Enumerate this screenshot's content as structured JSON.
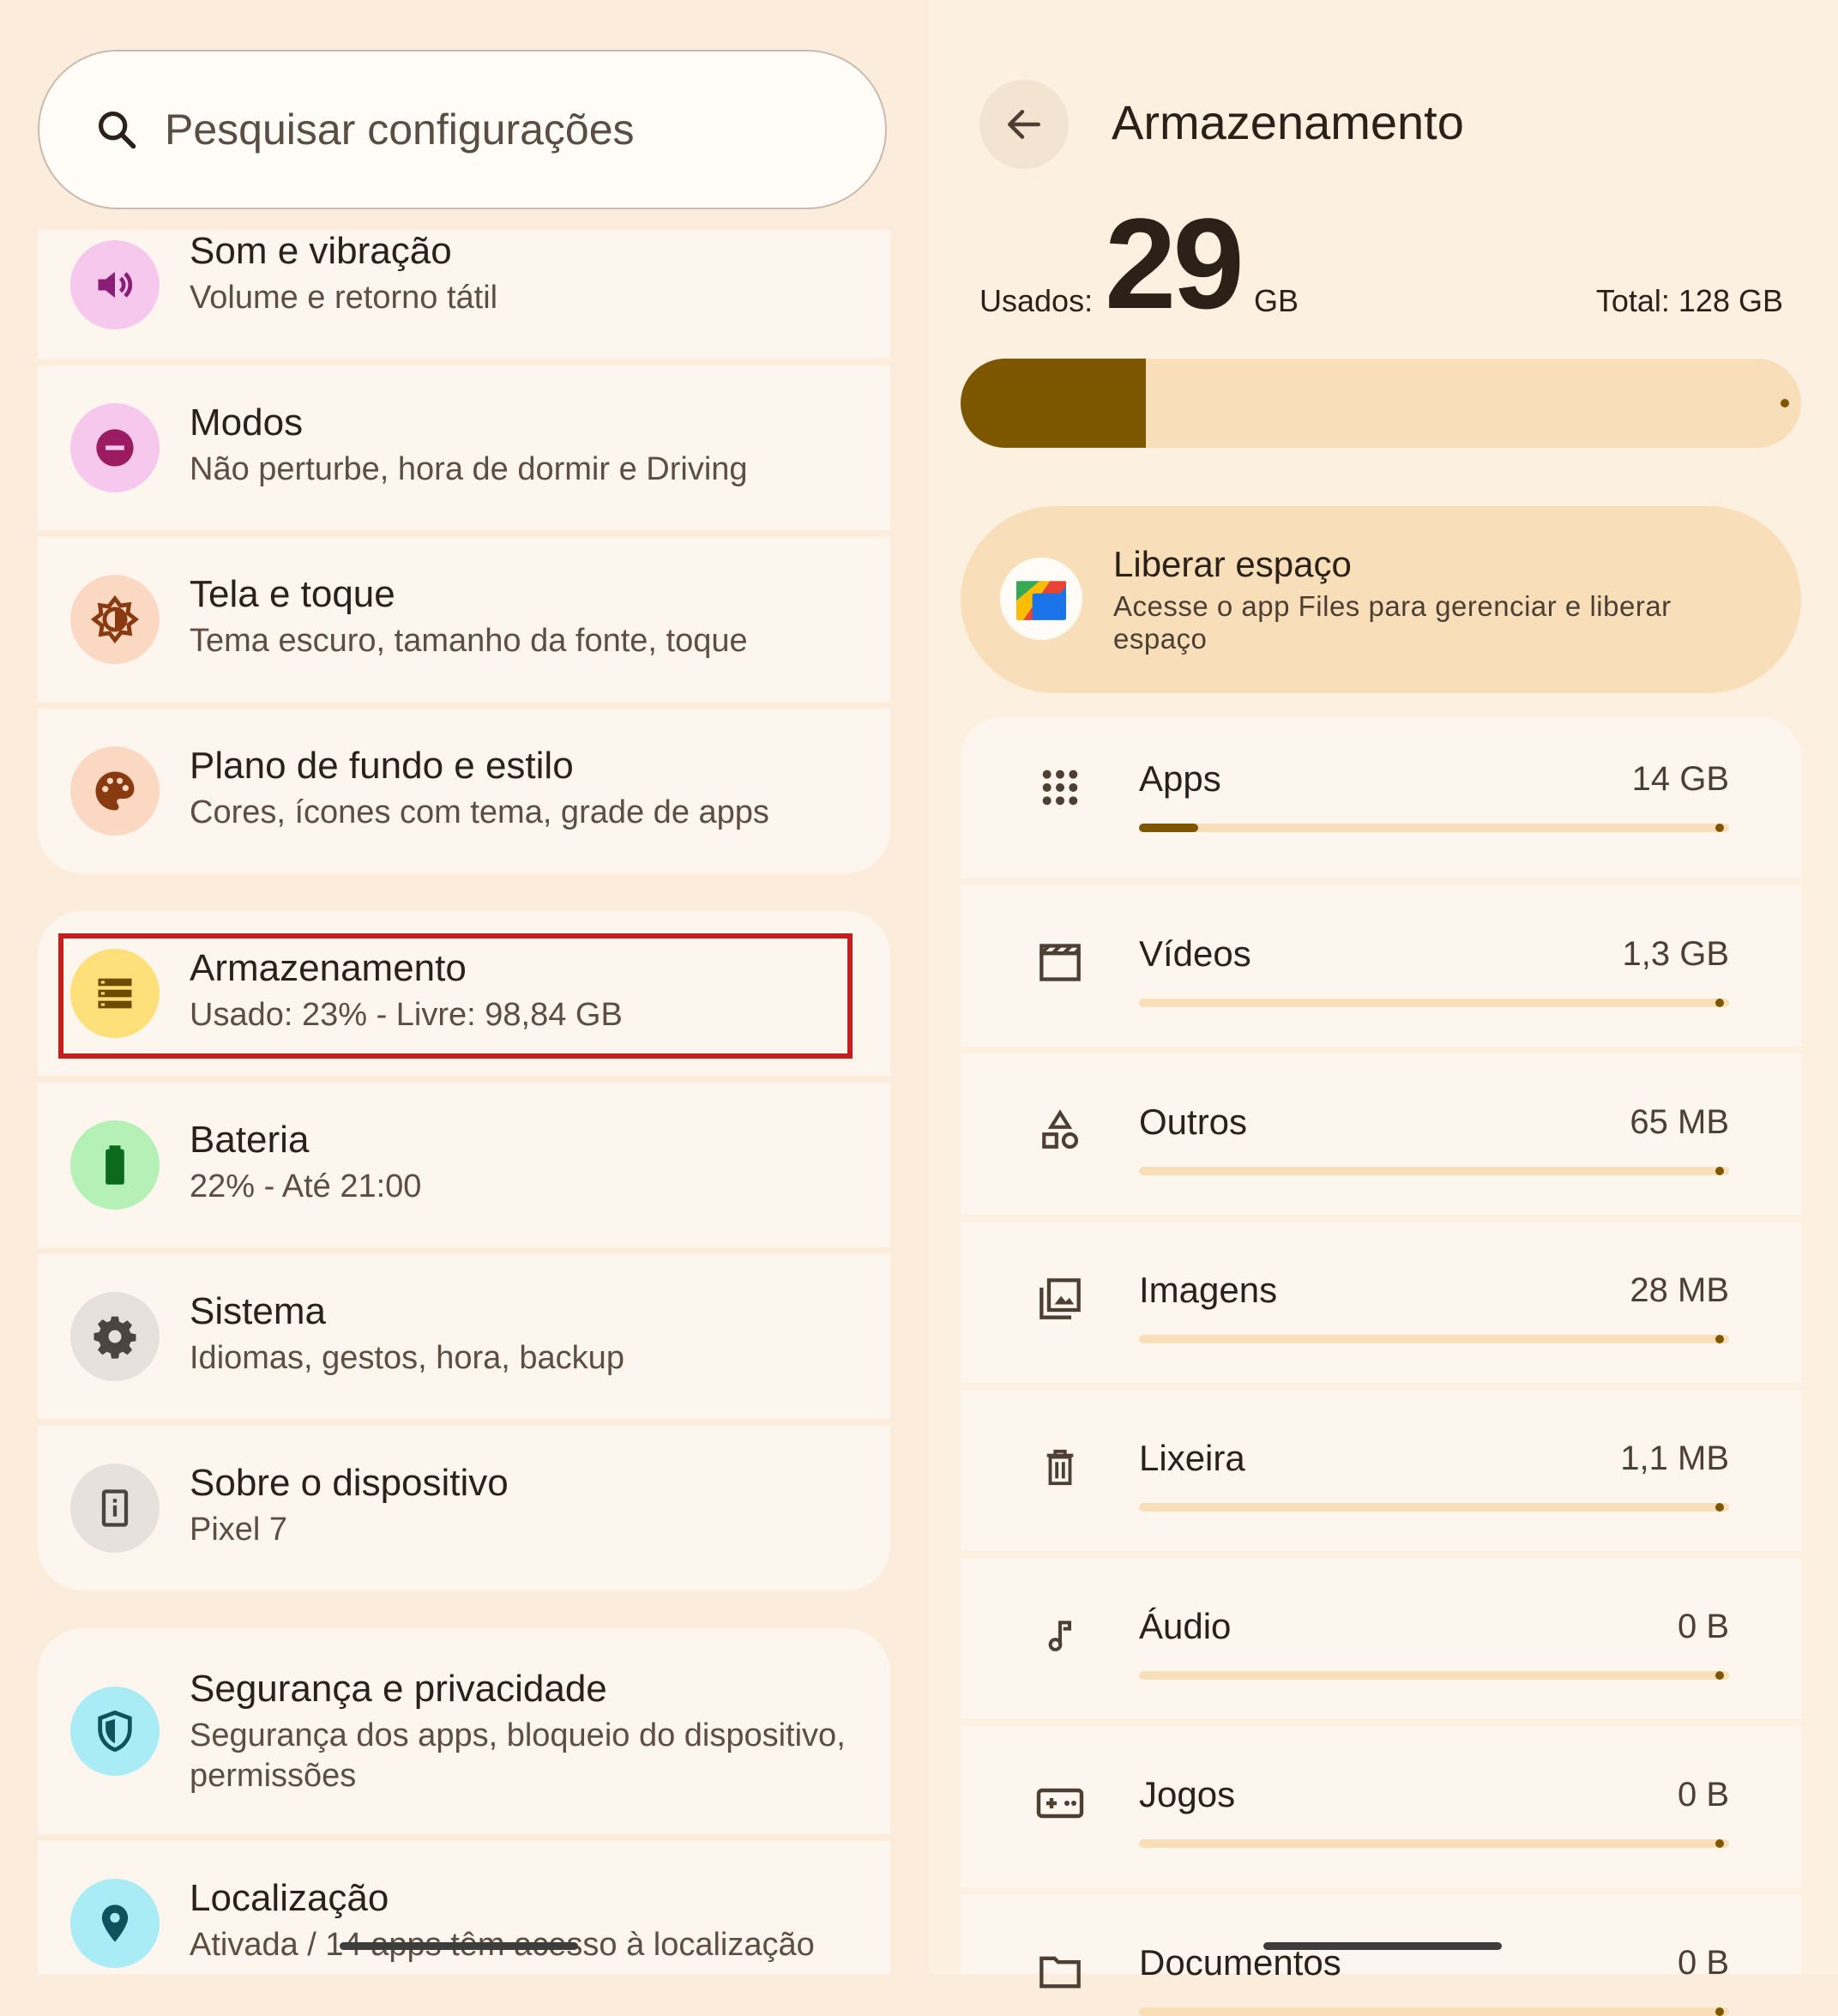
{
  "search": {
    "placeholder": "Pesquisar configurações"
  },
  "settings": [
    {
      "id": "som",
      "title": "Som e vibração",
      "subtitle": "Volume e retorno tátil",
      "icon": "volume-icon",
      "color": "#f7c8ee",
      "icon_color": "#8a1f78"
    },
    {
      "id": "modos",
      "title": "Modos",
      "subtitle": "Não perturbe, hora de dormir e Driving",
      "icon": "do-not-disturb-icon",
      "color": "#f7c8ee",
      "icon_color": "#9c1c62"
    },
    {
      "id": "tela",
      "title": "Tela e toque",
      "subtitle": "Tema escuro, tamanho da fonte, toque",
      "icon": "brightness-icon",
      "color": "#fbd8c2",
      "icon_color": "#8a3a10"
    },
    {
      "id": "plano",
      "title": "Plano de fundo e estilo",
      "subtitle": "Cores, ícones com tema, grade de apps",
      "icon": "palette-icon",
      "color": "#fbd8c2",
      "icon_color": "#8a3a10"
    },
    {
      "id": "armazenamento",
      "title": "Armazenamento",
      "subtitle": "Usado: 23% - Livre: 98,84 GB",
      "icon": "storage-icon",
      "color": "#fde07a",
      "icon_color": "#6d4c00"
    },
    {
      "id": "bateria",
      "title": "Bateria",
      "subtitle": "22% - Até 21:00",
      "icon": "battery-icon",
      "color": "#b5f0b6",
      "icon_color": "#0b6a1c"
    },
    {
      "id": "sistema",
      "title": "Sistema",
      "subtitle": "Idiomas, gestos, hora, backup",
      "icon": "gear-icon",
      "color": "#e6e1dc",
      "icon_color": "#4a4540"
    },
    {
      "id": "sobre",
      "title": "Sobre o dispositivo",
      "subtitle": "Pixel 7",
      "icon": "device-info-icon",
      "color": "#e6e1dc",
      "icon_color": "#4a4540"
    },
    {
      "id": "seguranca",
      "title": "Segurança e privacidade",
      "subtitle": "Segurança dos apps, bloqueio do dispositivo,",
      "subtitle2": "permissões",
      "icon": "shield-icon",
      "color": "#a9ecf5",
      "icon_color": "#0e5260"
    },
    {
      "id": "localizacao",
      "title": "Localização",
      "subtitle": "Ativada / 14 apps têm acesso à localização",
      "icon": "location-pin-icon",
      "color": "#a9ecf5",
      "icon_color": "#0e5260"
    }
  ],
  "storage": {
    "title": "Armazenamento",
    "used_label": "Usados:",
    "used_value": "29",
    "used_unit": "GB",
    "total": "Total: 128 GB",
    "used_fraction": 0.22,
    "free_space": {
      "title": "Liberar espaço",
      "description": "Acesse o app Files para gerenciar e liberar espaço"
    },
    "categories": [
      {
        "id": "apps",
        "label": "Apps",
        "size": "14 GB",
        "fraction": 0.1,
        "icon": "apps-grid-icon"
      },
      {
        "id": "videos",
        "label": "Vídeos",
        "size": "1,3 GB",
        "fraction": 0,
        "icon": "movie-icon"
      },
      {
        "id": "outros",
        "label": "Outros",
        "size": "65 MB",
        "fraction": 0,
        "icon": "shapes-icon"
      },
      {
        "id": "imagens",
        "label": "Imagens",
        "size": "28 MB",
        "fraction": 0,
        "icon": "image-icon"
      },
      {
        "id": "lixeira",
        "label": "Lixeira",
        "size": "1,1 MB",
        "fraction": 0,
        "icon": "trash-icon"
      },
      {
        "id": "audio",
        "label": "Áudio",
        "size": "0 B",
        "fraction": 0,
        "icon": "music-note-icon"
      },
      {
        "id": "jogos",
        "label": "Jogos",
        "size": "0 B",
        "fraction": 0,
        "icon": "gamepad-icon"
      },
      {
        "id": "documentos",
        "label": "Documentos",
        "size": "0 B",
        "fraction": 0,
        "icon": "folder-icon"
      }
    ]
  },
  "colors": {
    "accent": "#7d5700",
    "bar_track": "#f8dfb9",
    "highlight": "#c41f1f"
  }
}
